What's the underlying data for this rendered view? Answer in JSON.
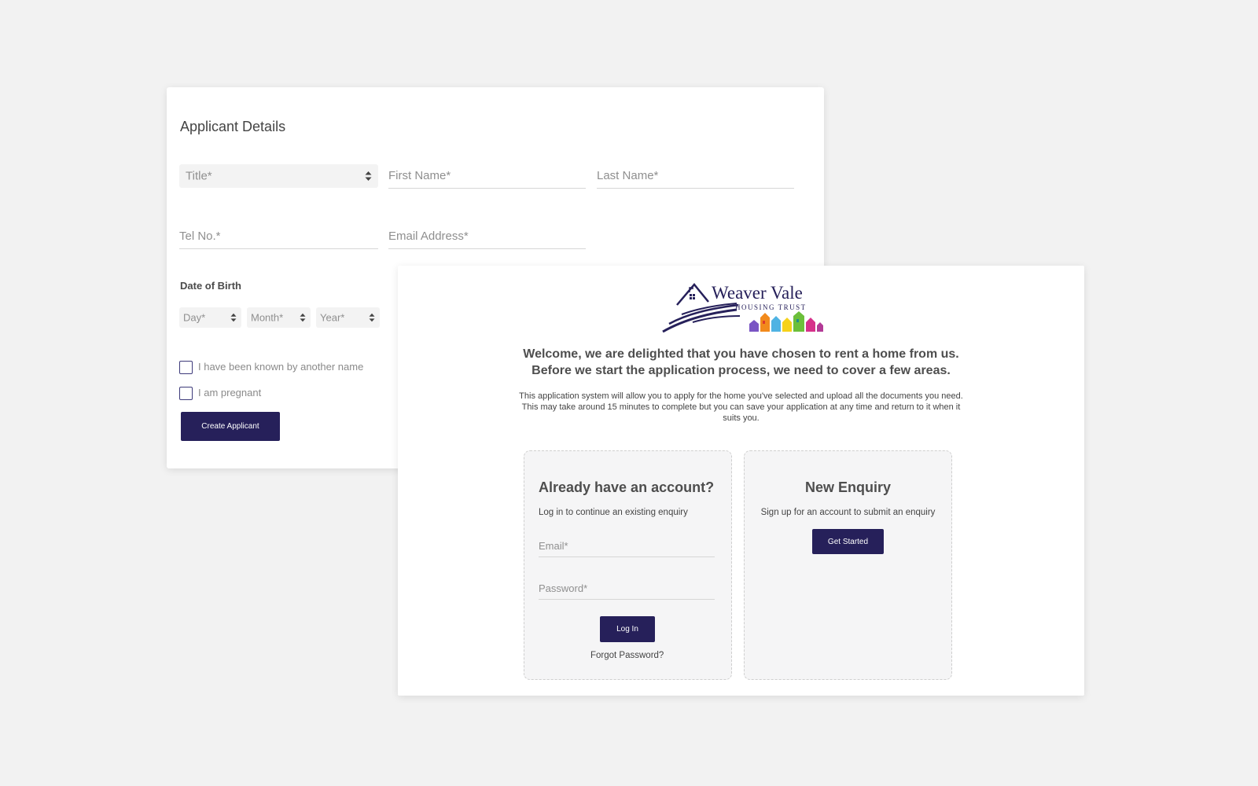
{
  "applicant_form": {
    "heading": "Applicant Details",
    "title_select": {
      "value": "Title*"
    },
    "first_name_placeholder": "First Name*",
    "last_name_placeholder": "Last Name*",
    "tel_placeholder": "Tel No.*",
    "email_placeholder": "Email Address*",
    "dob_label": "Date of Birth",
    "dob_day": "Day*",
    "dob_month": "Month*",
    "dob_year": "Year*",
    "checkbox_other_name": "I have been known by another name",
    "checkbox_pregnant": "I am pregnant",
    "submit_label": "Create Applicant"
  },
  "welcome": {
    "logo": {
      "name": "Weaver Vale",
      "sub": "HOUSING TRUST"
    },
    "line1": "Welcome, we are delighted that you have chosen to rent a home from us.",
    "line2": "Before we start the application process, we need to cover a few areas.",
    "intro_1": "This application system will allow you to apply for the home you've selected and upload all the documents you need.",
    "intro_2": "This may take around 15 minutes to complete but you can save your application at any time and return to it when it",
    "intro_3": "suits you.",
    "login": {
      "title": "Already have an account?",
      "subtitle": "Log in to continue an existing enquiry",
      "email_placeholder": "Email*",
      "password_placeholder": "Password*",
      "button": "Log In",
      "forgot": "Forgot Password?"
    },
    "enquiry": {
      "title": "New Enquiry",
      "subtitle": "Sign up for an account to submit an enquiry",
      "button": "Get Started"
    }
  },
  "colors": {
    "primary": "#26205a",
    "background": "#f2f2f2"
  }
}
